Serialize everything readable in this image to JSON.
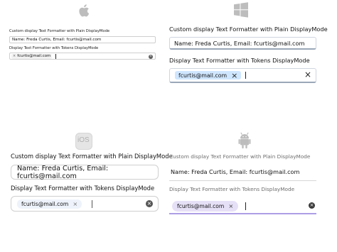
{
  "platforms": {
    "mac": {
      "icon": "apple-logo-icon"
    },
    "windows": {
      "icon": "windows-logo-icon"
    },
    "ios": {
      "icon": "ios-logo-icon",
      "logo_text": "iOS"
    },
    "android": {
      "icon": "android-logo-icon"
    }
  },
  "demo": {
    "plain_label": "Custom display Text Formatter with Plain DisplayMode",
    "plain_value": "Name: Freda Curtis, Email: fcurtis@mail.com",
    "tokens_label": "Display Text Formatter with Tokens DisplayMode",
    "token_value": "fcurtis@mail.com",
    "token_remove_glyph": "×",
    "clear_glyph": "×"
  },
  "colors": {
    "windows_token_bg": "#cfe6ff",
    "android_token_bg": "#e6e0f6",
    "android_accent": "#6b4fd2"
  }
}
